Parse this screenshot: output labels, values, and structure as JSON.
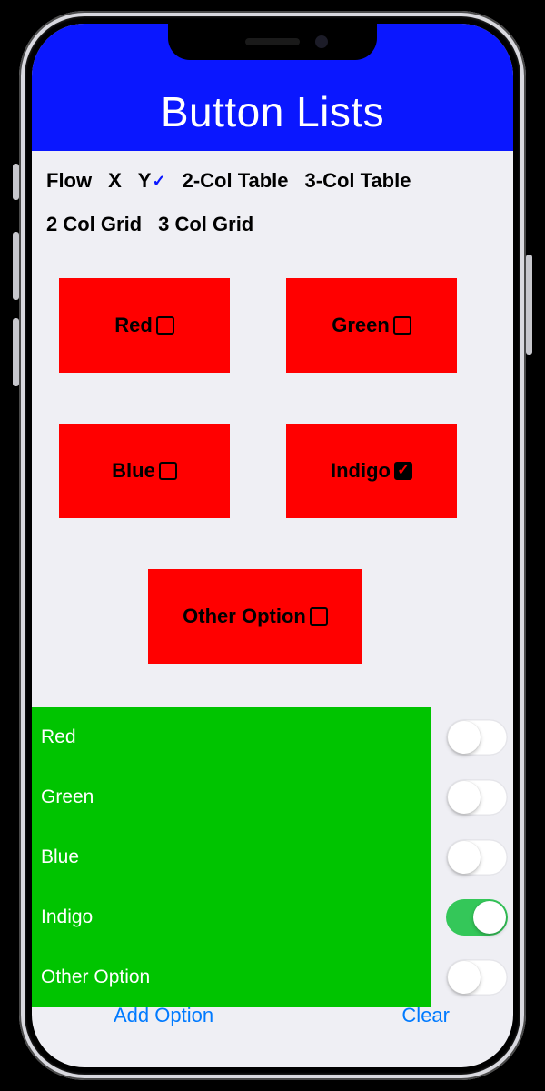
{
  "header": {
    "title": "Button Lists"
  },
  "tabs": [
    {
      "label": "Flow",
      "selected": false
    },
    {
      "label": "X",
      "selected": false
    },
    {
      "label": "Y",
      "selected": true
    },
    {
      "label": "2-Col Table",
      "selected": false
    },
    {
      "label": "3-Col Table",
      "selected": false
    },
    {
      "label": "2 Col Grid",
      "selected": false
    },
    {
      "label": "3 Col Grid",
      "selected": false
    }
  ],
  "options": [
    {
      "label": "Red",
      "checked": false
    },
    {
      "label": "Green",
      "checked": false
    },
    {
      "label": "Blue",
      "checked": false
    },
    {
      "label": "Indigo",
      "checked": true
    },
    {
      "label": "Other Option",
      "checked": false
    }
  ],
  "switches": [
    {
      "label": "Red",
      "on": false
    },
    {
      "label": "Green",
      "on": false
    },
    {
      "label": "Blue",
      "on": false
    },
    {
      "label": "Indigo",
      "on": true
    },
    {
      "label": "Other Option",
      "on": false
    }
  ],
  "toolbar": {
    "add_label": "Add Option",
    "clear_label": "Clear"
  },
  "colors": {
    "navbar": "#0a17ff",
    "button_bg": "#ff0000",
    "panel_bg": "#00c400",
    "ios_blue": "#007aff",
    "switch_on": "#34c759"
  }
}
